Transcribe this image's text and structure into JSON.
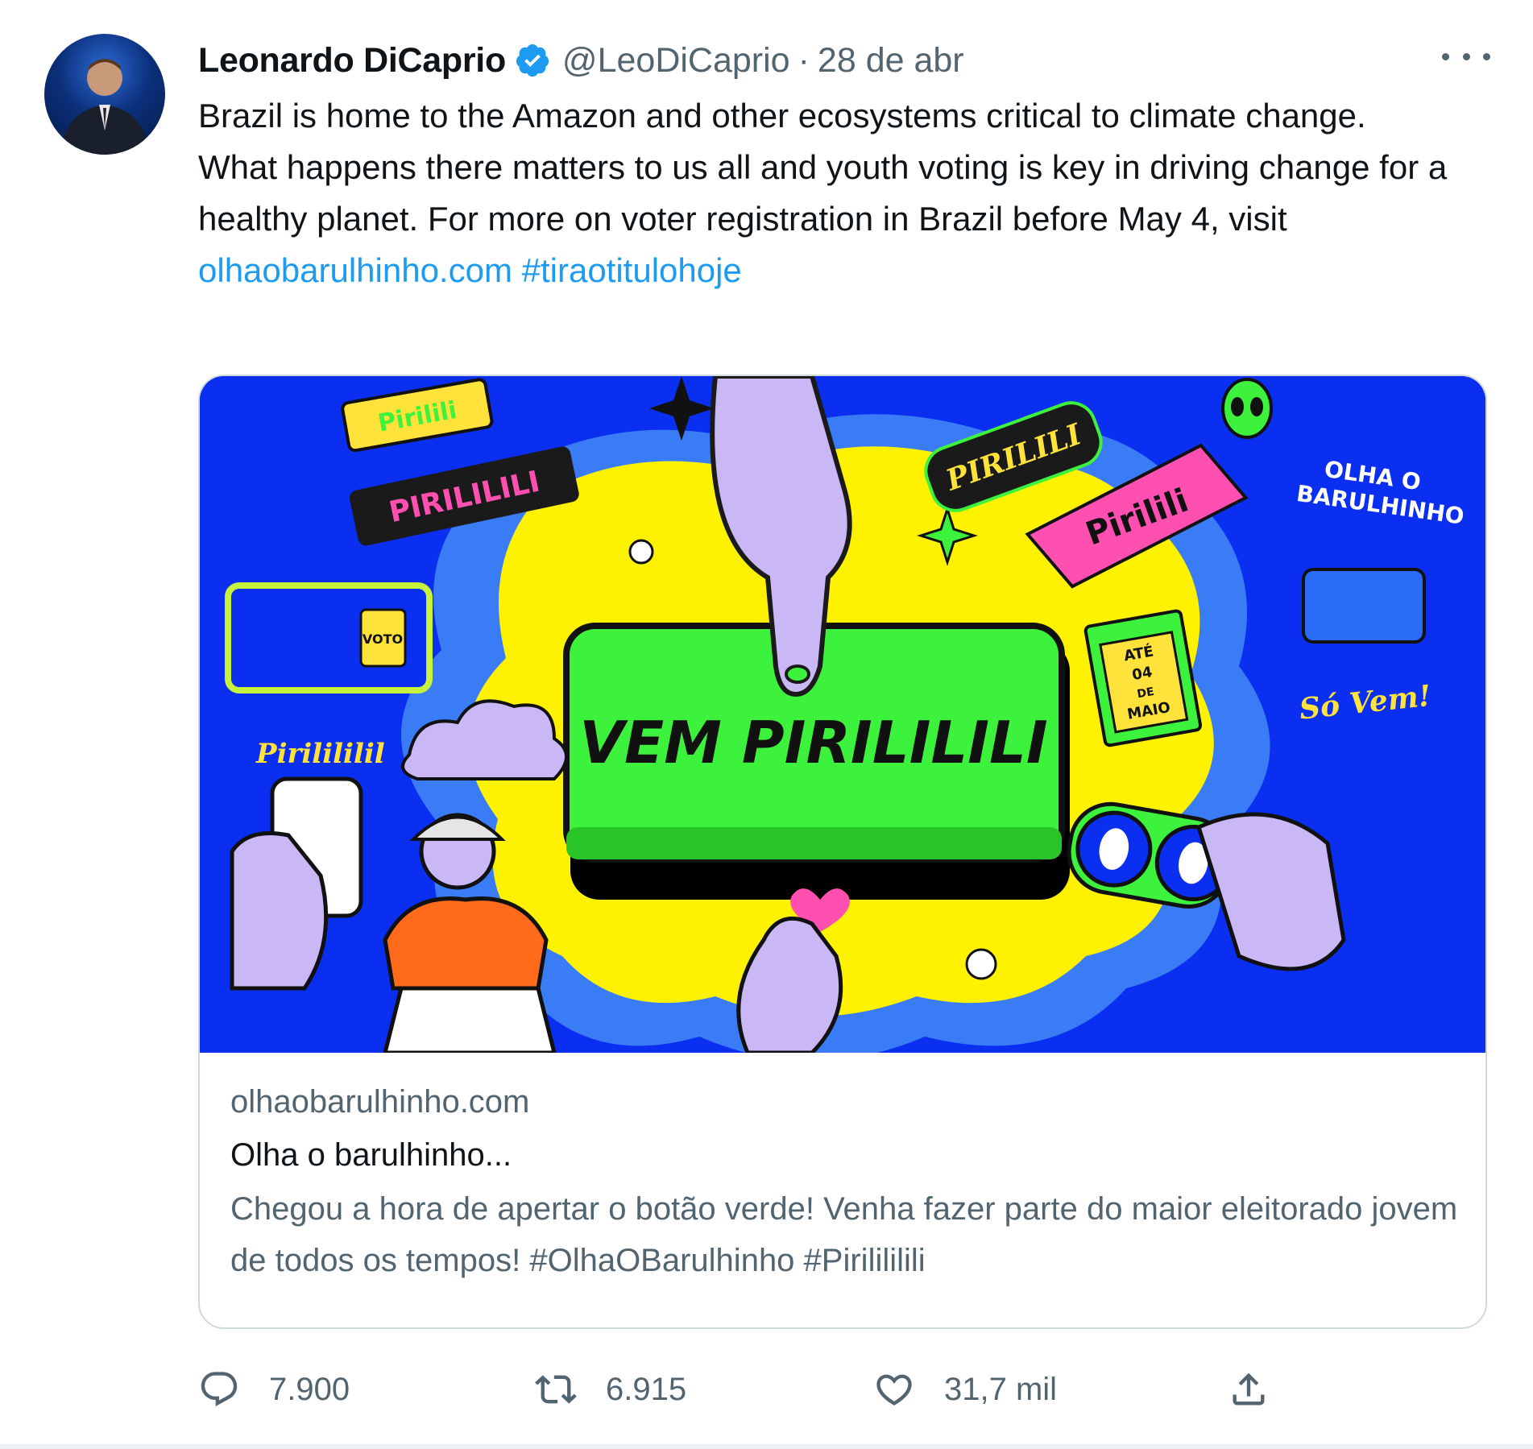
{
  "tweet": {
    "author_name": "Leonardo DiCaprio",
    "author_handle": "@LeoDiCaprio",
    "separator": "·",
    "date": "28 de abr",
    "text_line1": "Brazil is home to the Amazon and other ecosystems critical to climate change.",
    "text_line2": "What happens there matters to us all and youth voting is key in driving change for a healthy planet. For more on voter registration in Brazil before May 4, visit",
    "link": "olhaobarulhinho.com",
    "hashtag": "#tiraotitulohoje"
  },
  "card": {
    "image_texts": {
      "button_text": "VEM PIRILILILI",
      "sticker_1": "Pirilili",
      "sticker_2": "PIRILILILI",
      "sticker_3": "Pirilililil",
      "sticker_4": "PIRILILI",
      "sticker_5": "Pirilili",
      "olha_o": "OLHA O",
      "barulhinho": "BARULHINHO",
      "so_vem": "Só Vem!",
      "ate": "ATÉ",
      "date_04": "04",
      "de": "DE",
      "maio": "MAIO",
      "voto": "VOTO"
    },
    "domain": "olhaobarulhinho.com",
    "title": "Olha o barulhinho...",
    "description": "Chegou a hora de apertar o botão verde! Venha fazer parte do maior eleitorado jovem de todos os tempos! #OlhaOBarulhinho #Pirilililili"
  },
  "actions": {
    "reply_count": "7.900",
    "retweet_count": "6.915",
    "like_count": "31,7 mil"
  },
  "icons": {
    "verified": "verified-badge-icon",
    "more": "more-dots-icon",
    "reply": "reply-icon",
    "retweet": "retweet-icon",
    "like": "heart-icon",
    "share": "share-icon"
  },
  "colors": {
    "link": "#1d9bf0",
    "secondary_text": "#536471",
    "card_bg_blue": "#0b2ff0",
    "button_green": "#3cf23c",
    "splash_yellow": "#fff200"
  }
}
